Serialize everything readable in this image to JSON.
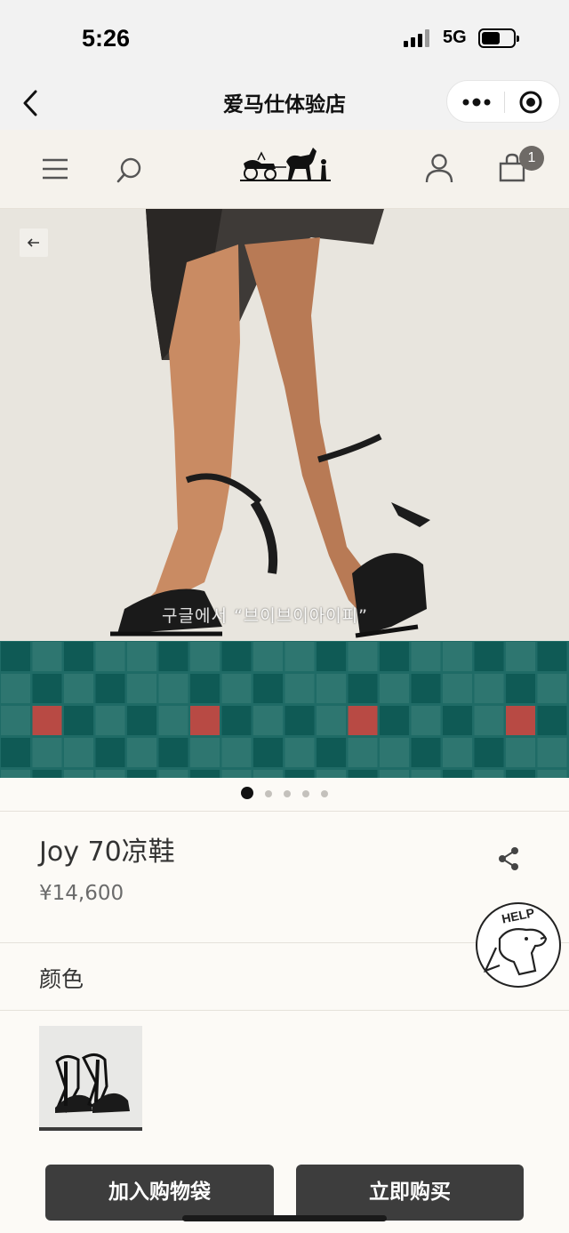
{
  "status_bar": {
    "time": "5:26",
    "network": "5G"
  },
  "titlebar": {
    "title": "爱马仕体验店"
  },
  "header": {
    "cart_count": "1"
  },
  "hero": {
    "watermark": "구글에서 “브이브이아이피”",
    "slide_count": 5,
    "active_slide": 0
  },
  "product": {
    "name": "Joy 70凉鞋",
    "price": "¥14,600"
  },
  "options": {
    "color_label": "颜色"
  },
  "help": {
    "label": "HELP"
  },
  "actions": {
    "add_to_bag": "加入购物袋",
    "buy_now": "立即购买"
  },
  "colors": {
    "tile_dark": "#0f5a55",
    "tile_mid": "#2e7670",
    "tile_red": "#b84a44",
    "button": "#3d3d3d",
    "background": "#fcfaf6"
  }
}
